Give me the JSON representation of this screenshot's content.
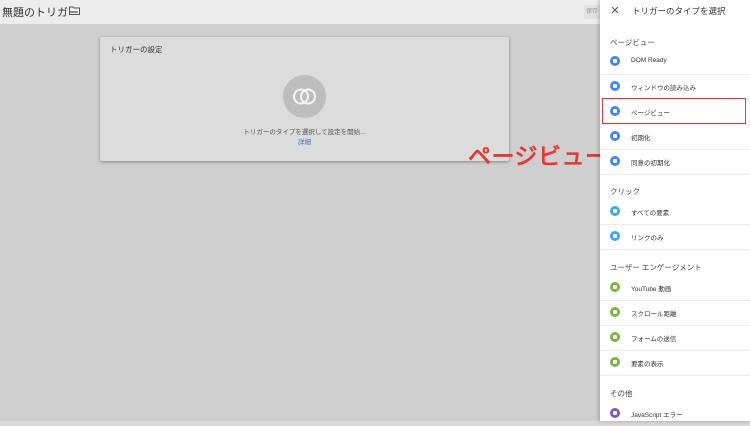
{
  "background": {
    "title": "無題のトリガー",
    "top_button": "保存",
    "card": {
      "title": "トリガーの設定",
      "hint": "トリガーのタイプを選択して設定を開始...",
      "link": "詳細"
    }
  },
  "annotation": "ページビューを選択",
  "panel": {
    "title": "トリガーのタイプを選択",
    "sections": [
      {
        "heading": "ページビュー",
        "items": [
          {
            "label": "DOM Ready",
            "icon": "document-icon",
            "color": "#4285f4"
          },
          {
            "label": "ウィンドウの読み込み",
            "icon": "window-icon",
            "color": "#4285f4"
          },
          {
            "label": "ページビュー",
            "icon": "eye-icon",
            "color": "#4285f4"
          },
          {
            "label": "初期化",
            "icon": "power-icon",
            "color": "#4285f4"
          },
          {
            "label": "同意の初期化",
            "icon": "consent-icon",
            "color": "#4285f4"
          }
        ]
      },
      {
        "heading": "クリック",
        "items": [
          {
            "label": "すべての要素",
            "icon": "cursor-icon",
            "color": "#42a5f5"
          },
          {
            "label": "リンクのみ",
            "icon": "link-icon",
            "color": "#42a5f5"
          }
        ]
      },
      {
        "heading": "ユーザー エンゲージメント",
        "items": [
          {
            "label": "YouTube 動画",
            "icon": "play-icon",
            "color": "#7cb342"
          },
          {
            "label": "スクロール距離",
            "icon": "scroll-icon",
            "color": "#7cb342"
          },
          {
            "label": "フォームの送信",
            "icon": "form-icon",
            "color": "#7cb342"
          },
          {
            "label": "要素の表示",
            "icon": "visibility-icon",
            "color": "#7cb342"
          }
        ]
      },
      {
        "heading": "その他",
        "items": [
          {
            "label": "JavaScript エラー",
            "icon": "warning-icon",
            "color": "#7e57c2"
          }
        ]
      }
    ]
  },
  "colors": {
    "highlight": "#e53935",
    "annotation": "#e53935",
    "link": "#3b6fc8"
  }
}
